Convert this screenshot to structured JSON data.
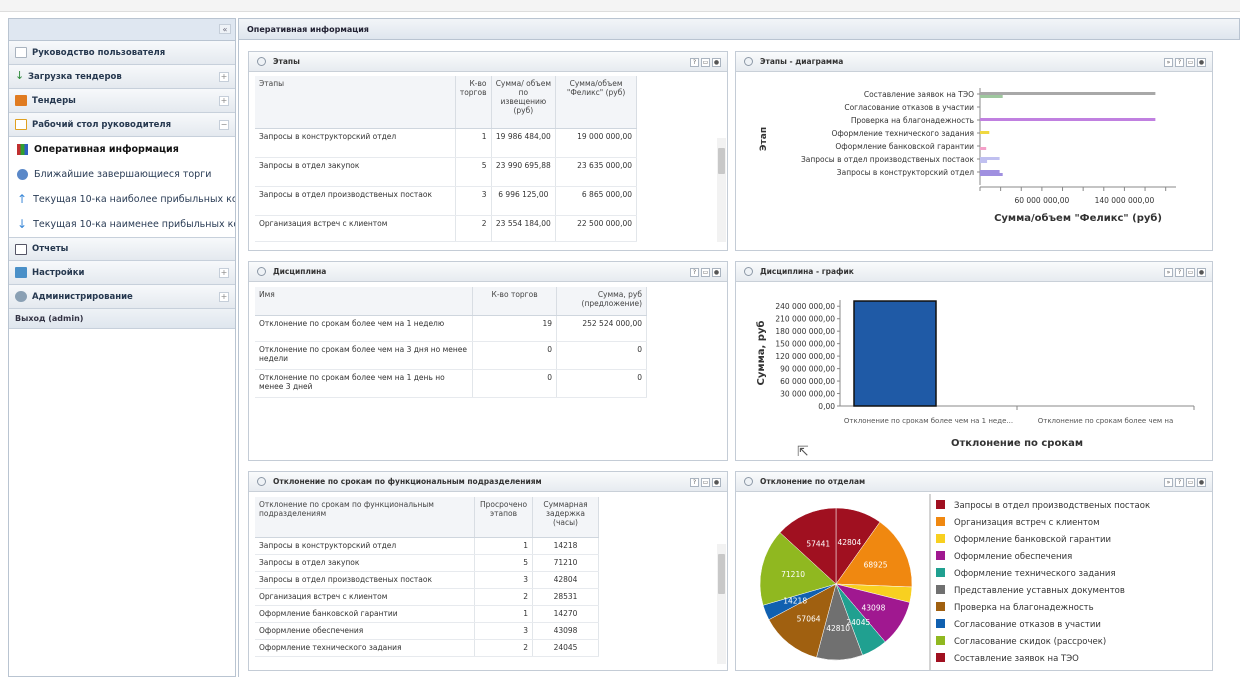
{
  "sidebar": {
    "collapse_icon": "«",
    "sections": [
      {
        "label": "Руководство пользователя",
        "icon": "doc-icon",
        "color": "#d8dde4"
      },
      {
        "label": "Загрузка тендеров",
        "icon": "download-icon",
        "color": "#2e8b3a"
      },
      {
        "label": "Тендеры",
        "icon": "folder-icon",
        "color": "#e07b20"
      },
      {
        "label": "Рабочий стол руководителя",
        "icon": "desk-icon",
        "color": "#e0a020"
      }
    ],
    "subitems": [
      {
        "label": "Оперативная информация",
        "color": "#c03030"
      },
      {
        "label": "Ближайшие завершающиеся торги",
        "color": "#4a78b8"
      },
      {
        "label": "Текущая 10-ка наиболее прибыльных ко",
        "color": "#3a88d8"
      },
      {
        "label": "Текущая 10-ка наименее прибыльных ко",
        "color": "#3a88d8"
      }
    ],
    "sections2": [
      {
        "label": "Отчеты",
        "color": "#fff"
      },
      {
        "label": "Настройки",
        "color": "#4a90c8"
      },
      {
        "label": "Администрирование",
        "color": "#8aa0b4"
      }
    ],
    "exit": "Выход (admin)"
  },
  "main_title": "Оперативная информация",
  "panels": {
    "stages": {
      "title": "Этапы",
      "headers": [
        "Этапы",
        "К-во торгов",
        "Сумма/ объем по извещению (руб)",
        "Сумма/объем \"Феликс\" (руб)"
      ],
      "rows": [
        [
          "Запросы в конструкторский отдел",
          "1",
          "19 986 484,00",
          "19 000 000,00"
        ],
        [
          "Запросы в отдел закупок",
          "5",
          "23 990 695,88",
          "23 635 000,00"
        ],
        [
          "Запросы в отдел производственых постаок",
          "3",
          "6 996 125,00",
          "6 865 000,00"
        ],
        [
          "Организация встреч с клиентом",
          "2",
          "23 554 184,00",
          "22 500 000,00"
        ]
      ]
    },
    "stages_chart": {
      "title": "Этапы - диаграмма",
      "ylabel": "Этап",
      "xlabel": "Сумма/объем \"Феликс\" (руб)",
      "xticks": [
        "0,00",
        "60 000 000,00",
        "140 000 000,00"
      ]
    },
    "discipline": {
      "title": "Дисциплина",
      "headers": [
        "Имя",
        "К-во торгов",
        "Сумма, руб (предложение)"
      ],
      "rows": [
        [
          "Отклонение по срокам более чем на 1 неделю",
          "19",
          "252 524 000,00"
        ],
        [
          "Отклонение по срокам более чем на 3 дня но менее недели",
          "0",
          "0"
        ],
        [
          "Отклонение по срокам более чем на 1 день но менее 3 дней",
          "0",
          "0"
        ]
      ]
    },
    "discipline_chart": {
      "title": "Дисциплина - график",
      "ylabel": "Сумма, руб",
      "xlabel": "Отклонение по срокам"
    },
    "deviation": {
      "title": "Отклонение по срокам по функциональным подразделениям",
      "headers": [
        "Отклонение по срокам по функциональным подразделениям",
        "Просрочено этапов",
        "Суммарная задержка (часы)"
      ],
      "rows": [
        [
          "Запросы в конструкторский отдел",
          "1",
          "14218"
        ],
        [
          "Запросы в отдел закупок",
          "5",
          "71210"
        ],
        [
          "Запросы в отдел производственых постаок",
          "3",
          "42804"
        ],
        [
          "Организация встреч с клиентом",
          "2",
          "28531"
        ],
        [
          "Оформление банковской гарантии",
          "1",
          "14270"
        ],
        [
          "Оформление обеспечения",
          "3",
          "43098"
        ],
        [
          "Оформление технического задания",
          "2",
          "24045"
        ]
      ]
    },
    "departments": {
      "title": "Отклонение по отделам"
    }
  },
  "chart_data": [
    {
      "type": "bar",
      "orientation": "horizontal",
      "categories": [
        "Составление заявок на ТЭО",
        "Согласование отказов в участии",
        "Проверка на благонадежность",
        "Оформление технического задания",
        "Оформление банковской гарантии",
        "Запросы в отдел производственых постаок",
        "Запросы в конструкторский отдел"
      ],
      "values": [
        170000000,
        0,
        170000000,
        9000000,
        0,
        19000000,
        19000000
      ],
      "secondary_values": [
        22000000,
        0,
        0,
        0,
        6000000,
        6865000,
        22000000
      ],
      "colors": [
        "#9ec79e",
        "#b8b8b8",
        "#c080e0",
        "#f0d840",
        "#f4a0c8",
        "#c0c0f0",
        "#a090e0"
      ],
      "xlabel": "Сумма/объем \"Феликс\" (руб)",
      "ylabel": "Этап",
      "xlim": [
        0,
        190000000
      ]
    },
    {
      "type": "bar",
      "categories": [
        "Отклонение по срокам более чем на 1 неде...",
        "Отклонение по срокам более чем на"
      ],
      "values": [
        252524000,
        0
      ],
      "ylabel": "Сумма, руб",
      "xlabel": "Отклонение по срокам",
      "yticks": [
        "0,00",
        "30 000 000,00",
        "60 000 000,00",
        "90 000 000,00",
        "120 000 000,00",
        "150 000 000,00",
        "180 000 000,00",
        "210 000 000,00",
        "240 000 000,00"
      ],
      "ylim": [
        0,
        255000000
      ],
      "color": "#1f5aa6"
    },
    {
      "type": "pie",
      "labels": [
        "Запросы в отдел производственых постаок",
        "Организация встреч с клиентом",
        "Оформление банковской гарантии",
        "Оформление обеспечения",
        "Оформление технического задания",
        "Представление уставных документов",
        "Проверка на благонадежность",
        "Согласование отказов в участии",
        "Согласование скидок (рассрочек)",
        "Составление заявок на ТЭО"
      ],
      "values": [
        42804,
        68925,
        14270,
        43098,
        24045,
        42810,
        57064,
        14218,
        71210,
        57441
      ],
      "value_labels": [
        "42804",
        "68925",
        "",
        "43098",
        "24045",
        "42810",
        "57064",
        "14218",
        "71210",
        "57441"
      ],
      "colors": [
        "#a01020",
        "#f08810",
        "#f8d020",
        "#a01890",
        "#20a090",
        "#707070",
        "#a06010",
        "#1060b0",
        "#90b820",
        "#a01020"
      ]
    }
  ]
}
